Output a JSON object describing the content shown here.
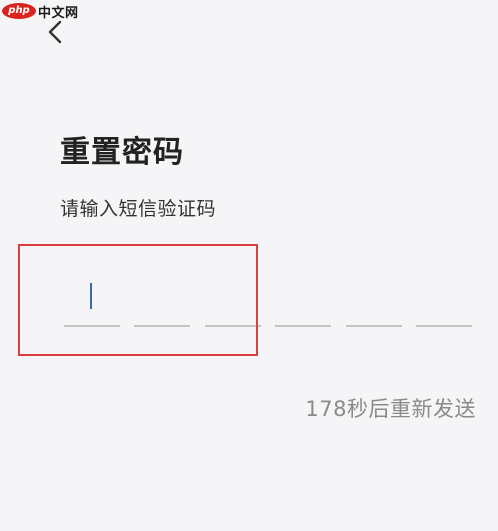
{
  "watermark": {
    "logo": "php",
    "text": "中文网"
  },
  "icons": {
    "back": "chevron-left-icon"
  },
  "page": {
    "title": "重置密码",
    "subtitle": "请输入短信验证码"
  },
  "code_input": {
    "length": 6,
    "active_index": 0,
    "values": [
      "",
      "",
      "",
      "",
      "",
      ""
    ]
  },
  "resend": {
    "countdown_text": "178秒后重新发送"
  },
  "colors": {
    "background": "#f5f5f7",
    "caret": "#3a6ea5",
    "underline": "#c5c5c5",
    "highlight": "#d94040",
    "muted_text": "#8a8a8a"
  }
}
